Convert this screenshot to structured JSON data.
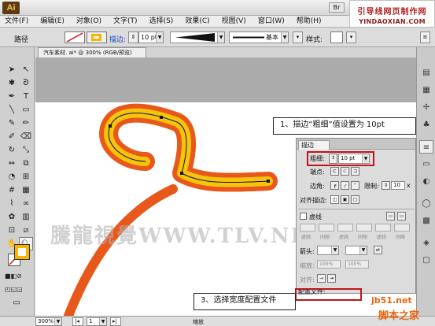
{
  "app": {
    "logo": "Ai",
    "br_button": "Br"
  },
  "site": {
    "title": "引导线网页制作网",
    "url": "YINDAOXIAN.COM"
  },
  "menu": [
    "文件(F)",
    "编辑(E)",
    "对象(O)",
    "文字(T)",
    "选择(S)",
    "效果(C)",
    "视图(V)",
    "窗口(W)",
    "帮助(H)"
  ],
  "control": {
    "object_type": "路径",
    "stroke_label": "描边:",
    "stroke_value": "10 pt",
    "profile_value": "基本",
    "style_label": "样式:"
  },
  "document": {
    "tab_title": "汽车素材. ai* @ 300% (RGB/预览)"
  },
  "watermark": "騰龍視覺WWW.TLV.NET",
  "callouts": {
    "c1": "1、描边“粗细”值设置为 10pt",
    "c2": "3、选择宽度配置文件"
  },
  "stroke_panel": {
    "tab": "描边",
    "weight_label": "粗细:",
    "weight_value": "10 pt",
    "cap_label": "端点:",
    "corner_label": "边角:",
    "limit_label": "限制:",
    "limit_value": "10",
    "limit_unit": "x",
    "align_label": "对齐描边:",
    "dashed_label": "虚线",
    "dash_labels": [
      "虚线",
      "间隙",
      "虚线",
      "间隙",
      "虚线",
      "间隙"
    ],
    "arrow_label": "箭头:",
    "scale_label": "缩放:",
    "scale_values": [
      "100%",
      "100%"
    ],
    "align_arrow_label": "对齐:",
    "profile_label": "配置文件:"
  },
  "status": {
    "zoom": "300%",
    "page": "1",
    "tool_name": "缩放"
  },
  "jb51": {
    "line1": "jb51.net",
    "line2": "脚本之家"
  },
  "colors": {
    "orange": "#e8581a",
    "yellow": "#f6c40c",
    "red_highlight": "#c2141d",
    "fill_swatch": "#f7b500"
  }
}
